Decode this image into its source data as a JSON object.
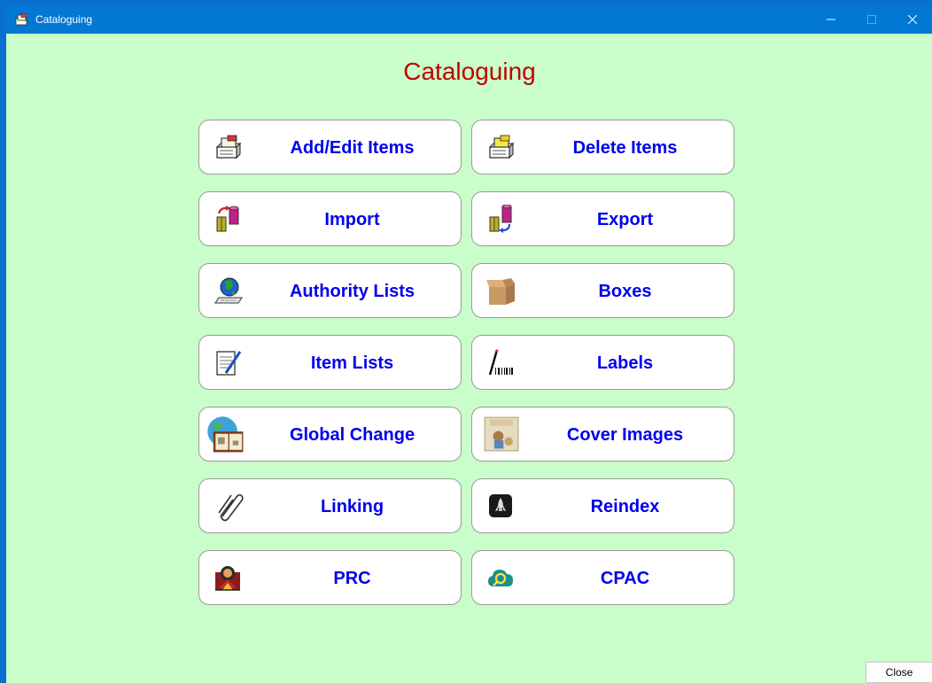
{
  "window": {
    "title": "Cataloguing"
  },
  "heading": "Cataloguing",
  "buttons": {
    "add_edit_items": "Add/Edit Items",
    "delete_items": "Delete Items",
    "import": "Import",
    "export": "Export",
    "authority_lists": "Authority Lists",
    "boxes": "Boxes",
    "item_lists": "Item Lists",
    "labels": "Labels",
    "global_change": "Global Change",
    "cover_images": "Cover Images",
    "linking": "Linking",
    "reindex": "Reindex",
    "prc": "PRC",
    "cpac": "CPAC"
  },
  "footer": {
    "close": "Close"
  },
  "icons": {
    "add_edit_items": "card-file-icon",
    "delete_items": "card-file-yellow-icon",
    "import": "import-book-icon",
    "export": "export-book-icon",
    "authority_lists": "globe-computer-icon",
    "boxes": "cardboard-box-icon",
    "item_lists": "notepad-pen-icon",
    "labels": "barcode-wand-icon",
    "global_change": "globe-book-icon",
    "cover_images": "book-cover-icon",
    "linking": "paperclip-icon",
    "reindex": "rocket-icon",
    "prc": "reading-person-icon",
    "cpac": "cloud-search-icon"
  },
  "colors": {
    "background": "#c9fdc9",
    "titlebar": "#0078d4",
    "heading": "#c00000",
    "button_text": "#0000ee"
  }
}
